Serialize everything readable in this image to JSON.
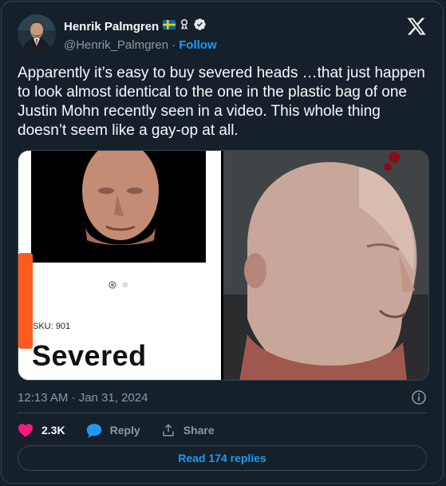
{
  "author": {
    "display_name": "Henrik Palmgren",
    "handle": "@Henrik_Palmgren",
    "separator": "·",
    "follow_label": "Follow"
  },
  "tweet": {
    "text": "Apparently it’s easy to buy severed  heads …that just happen to look almost identical to the one in the plastic bag of one Justin Mohn recently seen in a video. This whole thing doesn’t seem like a gay-op at all.",
    "timestamp": "12:13 AM · Jan 31, 2024"
  },
  "media": {
    "left_image": {
      "sku_label": "SKU: 901",
      "heading": "Severed"
    }
  },
  "actions": {
    "likes": "2.3K",
    "reply_label": "Reply",
    "share_label": "Share"
  },
  "footer": {
    "read_replies_label": "Read 174 replies"
  },
  "colors": {
    "background": "#15202b",
    "accent": "#1d9bf0",
    "like": "#f91880",
    "border": "#38444d",
    "muted": "#8b98a5"
  },
  "icons": [
    "x-logo-icon",
    "sweden-flag-icon",
    "ribbon-icon",
    "verified-badge-icon",
    "info-icon",
    "heart-icon",
    "reply-bubble-icon",
    "share-icon"
  ]
}
